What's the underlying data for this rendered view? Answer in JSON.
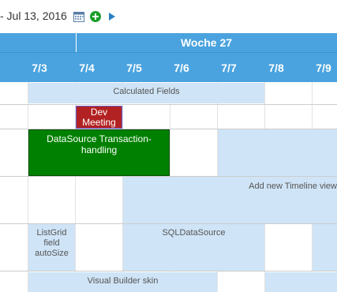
{
  "toolbar": {
    "date_range": "- Jul 13, 2016",
    "calendar_icon": "calendar-icon",
    "add_icon": "add-circle-icon",
    "next_icon": "next-arrow-icon"
  },
  "timeline": {
    "week_label": "Woche 27",
    "days": [
      "7/3",
      "7/4",
      "7/5",
      "7/6",
      "7/7",
      "7/8",
      "7/9"
    ]
  },
  "events": {
    "calculated_fields": "Calculated Fields",
    "dev_meeting": "Dev Meeting",
    "datasource_transaction": "DataSource Transaction-handling",
    "add_timeline_view": "Add new Timeline view",
    "listgrid_autosize": "ListGrid field autoSize",
    "sqldatasource": "SQLDataSource",
    "visual_builder": "Visual Builder skin"
  },
  "colors": {
    "header": "#4aa3df",
    "event_light": "#cfe4f6",
    "event_red": "#b22222",
    "event_green": "#008000"
  }
}
